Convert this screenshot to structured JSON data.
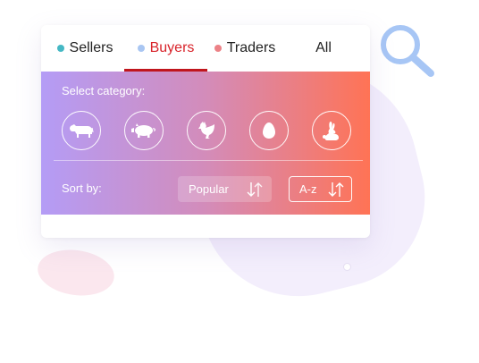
{
  "tabs": [
    {
      "label": "Sellers",
      "dot_color": "#45b8c4",
      "active": false
    },
    {
      "label": "Buyers",
      "dot_color": "#a9c6f2",
      "active": true
    },
    {
      "label": "Traders",
      "dot_color": "#ec8287",
      "active": false
    },
    {
      "label": "All",
      "dot_color": null,
      "active": false
    }
  ],
  "panel": {
    "category_label": "Select category:",
    "categories": [
      {
        "icon": "cow-icon"
      },
      {
        "icon": "pig-icon"
      },
      {
        "icon": "chicken-icon"
      },
      {
        "icon": "egg-icon"
      },
      {
        "icon": "rabbit-icon"
      }
    ],
    "sort_label": "Sort by:",
    "sort_popular_label": "Popular",
    "sort_az_label": "A-z"
  },
  "colors": {
    "accent_red": "#d8232a",
    "gradient_start": "#b49cf6",
    "gradient_end": "#ff7355"
  },
  "decorations": {
    "search_icon": "search-icon"
  }
}
